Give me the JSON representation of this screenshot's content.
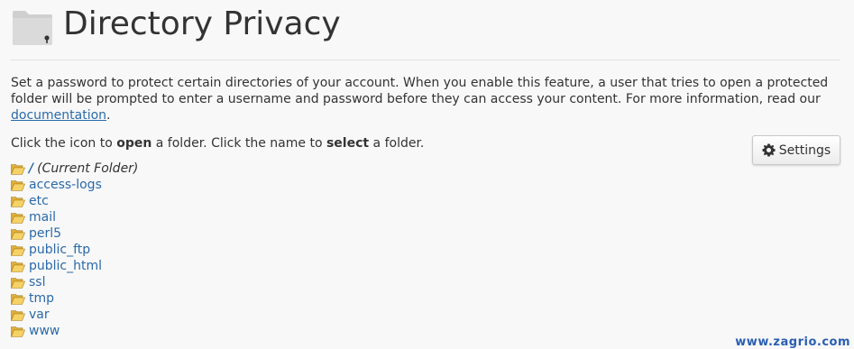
{
  "header": {
    "title": "Directory Privacy",
    "icon": "folder-lock-icon"
  },
  "description": {
    "text": "Set a password to protect certain directories of your account. When you enable this feature, a user that tries to open a protected folder will be prompted to enter a username and password before they can access your content. For more information, read our ",
    "link_label": "documentation",
    "suffix": "."
  },
  "instructions": {
    "part1": "Click the icon to ",
    "bold1": "open",
    "part2": " a folder. Click the name to ",
    "bold2": "select",
    "part3": " a folder."
  },
  "settings_button": {
    "label": "Settings",
    "icon": "gear-icon"
  },
  "folder_tree": {
    "root": {
      "name": "/",
      "note": "(Current Folder)"
    },
    "folders": [
      "access-logs",
      "etc",
      "mail",
      "perl5",
      "public_ftp",
      "public_html",
      "ssl",
      "tmp",
      "var",
      "www"
    ],
    "icon": "open-folder-icon"
  },
  "watermark": "www.zagrio.com",
  "colors": {
    "link": "#2a6aa8",
    "text": "#333333",
    "background": "#f8f8f8",
    "folder_icon": "#f0c24b"
  }
}
